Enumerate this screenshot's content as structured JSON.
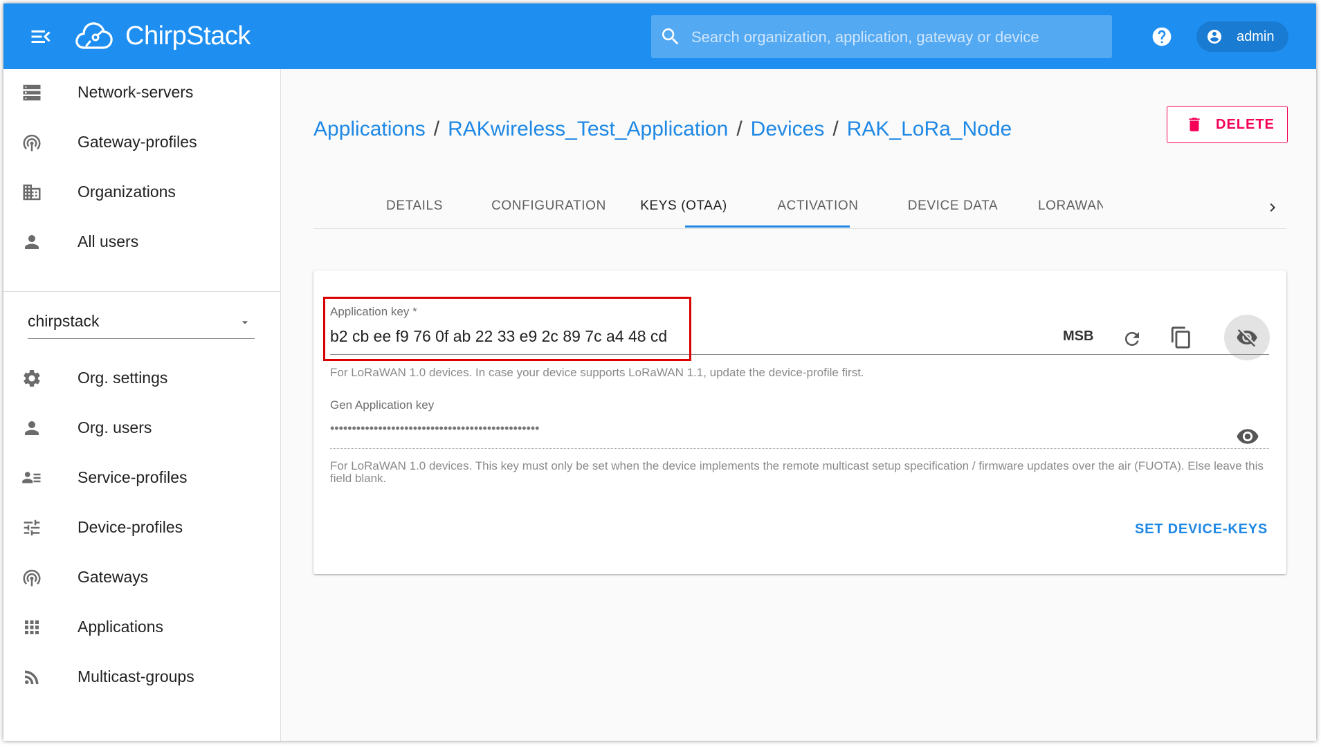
{
  "app": {
    "brand": "ChirpStack",
    "search_placeholder": "Search organization, application, gateway or device",
    "user": "admin"
  },
  "sidebar": {
    "top_items": [
      {
        "label": "Network-servers",
        "icon": "server-icon"
      },
      {
        "label": "Gateway-profiles",
        "icon": "gateway-icon"
      },
      {
        "label": "Organizations",
        "icon": "building-icon"
      },
      {
        "label": "All users",
        "icon": "person-icon"
      }
    ],
    "org_selected": "chirpstack",
    "org_items": [
      {
        "label": "Org. settings",
        "icon": "gear-icon"
      },
      {
        "label": "Org. users",
        "icon": "person-icon"
      },
      {
        "label": "Service-profiles",
        "icon": "account-details-icon"
      },
      {
        "label": "Device-profiles",
        "icon": "tune-icon"
      },
      {
        "label": "Gateways",
        "icon": "gateway-icon"
      },
      {
        "label": "Applications",
        "icon": "apps-grid-icon"
      },
      {
        "label": "Multicast-groups",
        "icon": "rss-icon"
      }
    ]
  },
  "breadcrumb": {
    "items": [
      "Applications",
      "RAKwireless_Test_Application",
      "Devices",
      "RAK_LoRa_Node"
    ],
    "separator": "/"
  },
  "actions": {
    "delete_label": "DELETE"
  },
  "tabs": {
    "items": [
      "DETAILS",
      "CONFIGURATION",
      "KEYS (OTAA)",
      "ACTIVATION",
      "DEVICE DATA",
      "LORAWAN FRAMES"
    ],
    "active_index": 2
  },
  "keys": {
    "app_key": {
      "label": "Application key *",
      "value": "b2 cb ee f9 76 0f ab 22 33 e9 2c 89 7c a4 48 cd",
      "byte_order": "MSB",
      "helper": "For LoRaWAN 1.0 devices. In case your device supports LoRaWAN 1.1, update the device-profile first."
    },
    "gen_app_key": {
      "label": "Gen Application key",
      "masked_value": "••••••••••••••••••••••••••••••••••••••••••••••••",
      "helper": "For LoRaWAN 1.0 devices. This key must only be set when the device implements the remote multicast setup specification / firmware updates over the air (FUOTA). Else leave this field blank."
    },
    "submit_label": "SET DEVICE-KEYS"
  },
  "colors": {
    "appbar": "#1e8ff1",
    "link": "#1e88e5",
    "danger": "#f50057",
    "highlight_box": "#d80000"
  }
}
